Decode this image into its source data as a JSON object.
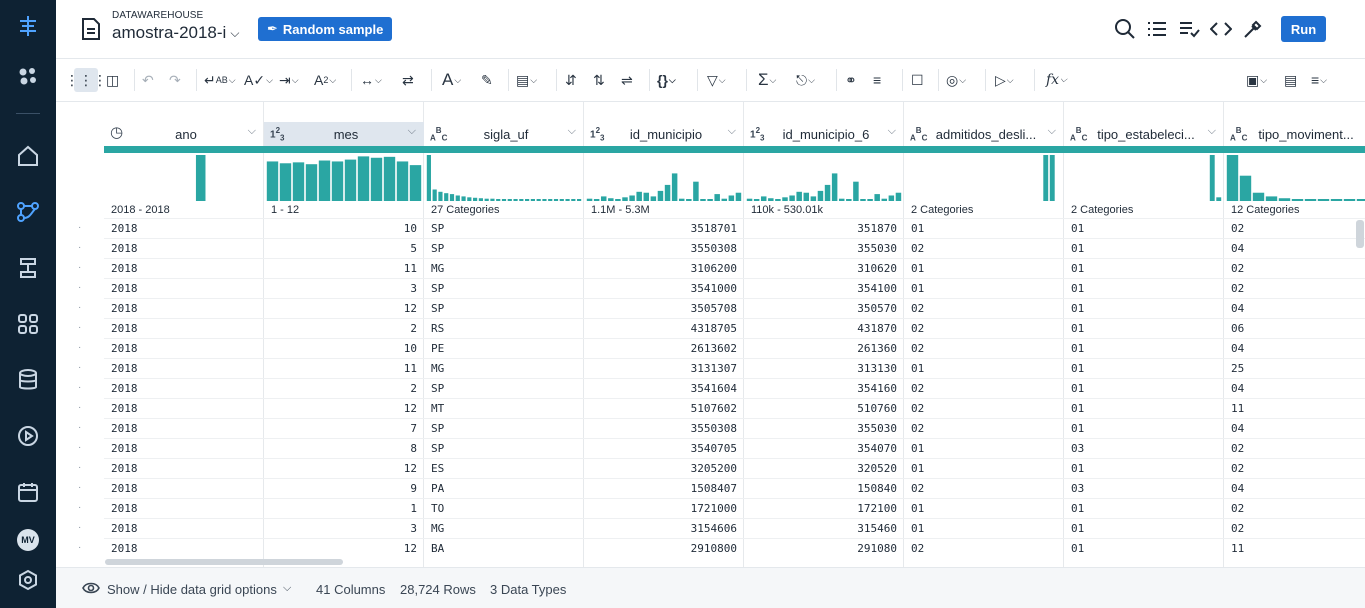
{
  "colors": {
    "sidebar": "#0e2233",
    "accent": "#1f6fd1",
    "bars": "#2aa6a3"
  },
  "sidebar": {
    "icons": [
      "logo-icon",
      "dots-cluster-icon",
      "home-icon",
      "flow-icon",
      "pipeline-icon",
      "grid-apps-icon",
      "database-icon",
      "play-circle-icon",
      "calendar-icon",
      "gear-hex-icon"
    ],
    "avatar": "MV"
  },
  "header": {
    "datasource": "DATAWAREHOUSE",
    "title": "amostra-2018-i",
    "sample_button": "Random sample",
    "run_button": "Run",
    "tools": [
      "search-icon",
      "list-icon",
      "checklist-icon",
      "code-icon",
      "pipette-icon"
    ]
  },
  "toolbar": {
    "groups": [
      [
        "grid-dots-icon",
        "columns-icon"
      ],
      [
        "undo-icon",
        "redo-icon"
      ],
      [
        "change-type-icon",
        "validate-icon",
        "move-column-icon",
        "rename-icon"
      ],
      [
        "split-icon",
        "merge-icon"
      ],
      [
        "text-format-icon",
        "clean-icon"
      ],
      [
        "table-icon"
      ],
      [
        "restructure-icon",
        "pivot-icon",
        "replace-icon"
      ],
      [
        "braces-icon"
      ],
      [
        "filter-icon"
      ],
      [
        "sum-icon",
        "hierarchy-icon"
      ],
      [
        "join-icon",
        "sort-icon"
      ],
      [
        "comment-icon"
      ],
      [
        "target-icon"
      ],
      [
        "macro-icon"
      ],
      [
        "function-icon"
      ],
      [
        "layout-icon",
        "chart-icon",
        "settings-sliders-icon"
      ]
    ]
  },
  "grid": {
    "columns": [
      {
        "type": "clock",
        "name": "ano",
        "range": "2018 - 2018",
        "align": "left",
        "hist": [
          0,
          0,
          0,
          0,
          0,
          0,
          0,
          0,
          1,
          0,
          0,
          0,
          0,
          0
        ]
      },
      {
        "type": "123",
        "name": "mes",
        "range": "1 - 12",
        "align": "right",
        "hist": [
          0.86,
          0.82,
          0.84,
          0.8,
          0.88,
          0.86,
          0.9,
          0.97,
          0.94,
          0.96,
          0.86,
          0.78
        ],
        "selected": true
      },
      {
        "type": "ABC",
        "name": "sigla_uf",
        "range": "27 Categories",
        "align": "left",
        "hist": [
          1,
          0.25,
          0.2,
          0.17,
          0.15,
          0.12,
          0.1,
          0.08,
          0.07,
          0.06,
          0.05,
          0.05,
          0.04,
          0.04,
          0.03,
          0.03,
          0.03,
          0.02,
          0.02,
          0.02,
          0.02,
          0.01,
          0.01,
          0.01,
          0.01,
          0.01,
          0.01
        ]
      },
      {
        "type": "123",
        "name": "id_municipio",
        "range": "1.1M - 5.3M",
        "align": "right",
        "hist": [
          0.05,
          0.04,
          0.1,
          0.06,
          0.02,
          0.08,
          0.12,
          0.2,
          0.18,
          0.1,
          0.22,
          0.35,
          0.6,
          0.05,
          0.04,
          0.42,
          0.03,
          0.02,
          0.15,
          0.05,
          0.12,
          0.18
        ]
      },
      {
        "type": "123",
        "name": "id_municipio_6",
        "range": "110k - 530.01k",
        "align": "right",
        "hist": [
          0.05,
          0.04,
          0.1,
          0.06,
          0.02,
          0.08,
          0.12,
          0.2,
          0.18,
          0.1,
          0.22,
          0.35,
          0.6,
          0.05,
          0.04,
          0.42,
          0.03,
          0.02,
          0.15,
          0.05,
          0.12,
          0.18
        ]
      },
      {
        "type": "ABC",
        "name": "admitidos_desli...",
        "range": "2 Categories",
        "align": "left",
        "hist": [
          0,
          0,
          0,
          0,
          0,
          0,
          0,
          0,
          0,
          0,
          0,
          0,
          0,
          0,
          0,
          0,
          0,
          0,
          0,
          0,
          0,
          1,
          1,
          0
        ]
      },
      {
        "type": "ABC",
        "name": "tipo_estabeleci...",
        "range": "2 Categories",
        "align": "left",
        "hist": [
          0,
          0,
          0,
          0,
          0,
          0,
          0,
          0,
          0,
          0,
          0,
          0,
          0,
          0,
          0,
          0,
          0,
          0,
          0,
          0,
          0,
          0,
          1,
          0.08
        ]
      },
      {
        "type": "ABC",
        "name": "tipo_moviment...",
        "range": "12 Categories",
        "align": "left",
        "hist": [
          1,
          0.55,
          0.18,
          0.1,
          0.06,
          0.04,
          0.03,
          0.02,
          0.02,
          0.02,
          0.01,
          0.01
        ]
      }
    ],
    "rows": [
      [
        "2018",
        "10",
        "SP",
        "3518701",
        "351870",
        "01",
        "01",
        "02"
      ],
      [
        "2018",
        "5",
        "SP",
        "3550308",
        "355030",
        "02",
        "01",
        "04"
      ],
      [
        "2018",
        "11",
        "MG",
        "3106200",
        "310620",
        "01",
        "01",
        "02"
      ],
      [
        "2018",
        "3",
        "SP",
        "3541000",
        "354100",
        "01",
        "01",
        "02"
      ],
      [
        "2018",
        "12",
        "SP",
        "3505708",
        "350570",
        "02",
        "01",
        "04"
      ],
      [
        "2018",
        "2",
        "RS",
        "4318705",
        "431870",
        "02",
        "01",
        "06"
      ],
      [
        "2018",
        "10",
        "PE",
        "2613602",
        "261360",
        "02",
        "01",
        "04"
      ],
      [
        "2018",
        "11",
        "MG",
        "3131307",
        "313130",
        "01",
        "01",
        "25"
      ],
      [
        "2018",
        "2",
        "SP",
        "3541604",
        "354160",
        "02",
        "01",
        "04"
      ],
      [
        "2018",
        "12",
        "MT",
        "5107602",
        "510760",
        "02",
        "01",
        "11"
      ],
      [
        "2018",
        "7",
        "SP",
        "3550308",
        "355030",
        "02",
        "01",
        "04"
      ],
      [
        "2018",
        "8",
        "SP",
        "3540705",
        "354070",
        "01",
        "03",
        "02"
      ],
      [
        "2018",
        "12",
        "ES",
        "3205200",
        "320520",
        "01",
        "01",
        "02"
      ],
      [
        "2018",
        "9",
        "PA",
        "1508407",
        "150840",
        "02",
        "03",
        "04"
      ],
      [
        "2018",
        "1",
        "TO",
        "1721000",
        "172100",
        "01",
        "01",
        "02"
      ],
      [
        "2018",
        "3",
        "MG",
        "3154606",
        "315460",
        "01",
        "01",
        "02"
      ],
      [
        "2018",
        "12",
        "BA",
        "2910800",
        "291080",
        "02",
        "01",
        "11"
      ]
    ]
  },
  "footer": {
    "options_label": "Show / Hide data grid options",
    "columns": "41 Columns",
    "rows": "28,724 Rows",
    "types": "3 Data Types"
  }
}
